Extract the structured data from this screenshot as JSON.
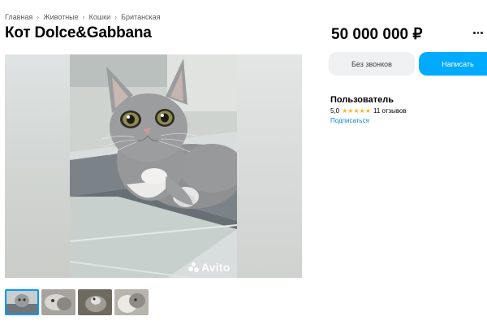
{
  "breadcrumbs": [
    "Главная",
    "Животные",
    "Кошки",
    "Британская"
  ],
  "breadcrumb_separator": "›",
  "listing": {
    "title": "Кот Dolce&Gabbana",
    "price": "50 000 000 ₽"
  },
  "gallery": {
    "watermark": "Avito",
    "thumbnail_count": 4,
    "active_thumbnail": 1
  },
  "actions": {
    "no_calls_label": "Без звонков",
    "write_label": "Написать"
  },
  "seller": {
    "name": "Пользователь",
    "rating": "5,0",
    "stars": "★★★★★",
    "reviews": "11 отзывов",
    "subscribe_label": "Подписаться"
  },
  "colors": {
    "accent": "#00aaff",
    "link": "#0a84e0",
    "star": "#ffb021"
  },
  "icons": [
    "more-dots-icon",
    "chevron-right-icon",
    "avito-logo-icon"
  ]
}
